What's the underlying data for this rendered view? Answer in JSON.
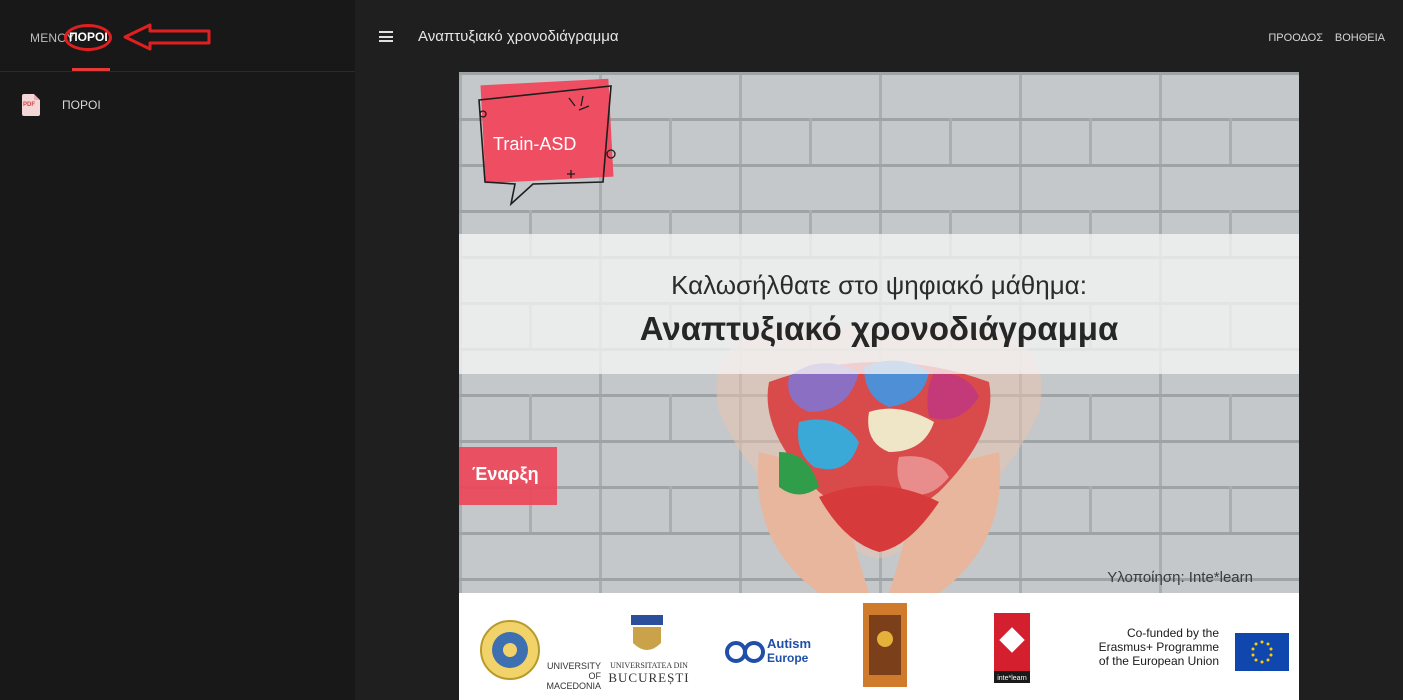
{
  "sidebar": {
    "tabs": [
      {
        "label": "ΜΕΝΟΥ"
      },
      {
        "label": "ΠΟΡΟΙ"
      }
    ],
    "items": [
      {
        "label": "ΠΟΡΟΙ",
        "icon": "pdf-icon"
      }
    ]
  },
  "header": {
    "title": "Αναπτυξιακό χρονοδιάγραμμα",
    "nav": [
      "ΠΡΟΟΔΟΣ",
      "ΒΟΗΘΕΙΑ"
    ]
  },
  "slide": {
    "badge": "Train-ASD",
    "welcome": "Καλωσήλθατε στο ψηφιακό μάθημα:",
    "headline": "Αναπτυξιακό χρονοδιάγραμμα",
    "start": "Έναρξη",
    "credit": "Υλοποίηση: Inte*learn",
    "logos": {
      "macedonia": [
        "UNIVERSITY",
        "OF MACEDONIA"
      ],
      "bucuresti": [
        "UNIVERSITATEA DIN",
        "BUCUREȘTI"
      ],
      "autism": [
        "Autism",
        "Europe"
      ],
      "intelearn": "inte*learn",
      "erasmus": [
        "Co-funded by the",
        "Erasmus+ Programme",
        "of the European Union"
      ]
    }
  },
  "colors": {
    "accent": "#e53935",
    "badge": "#ee4d62",
    "sidebar_bg": "#181818",
    "main_bg": "#1f1f1f"
  }
}
